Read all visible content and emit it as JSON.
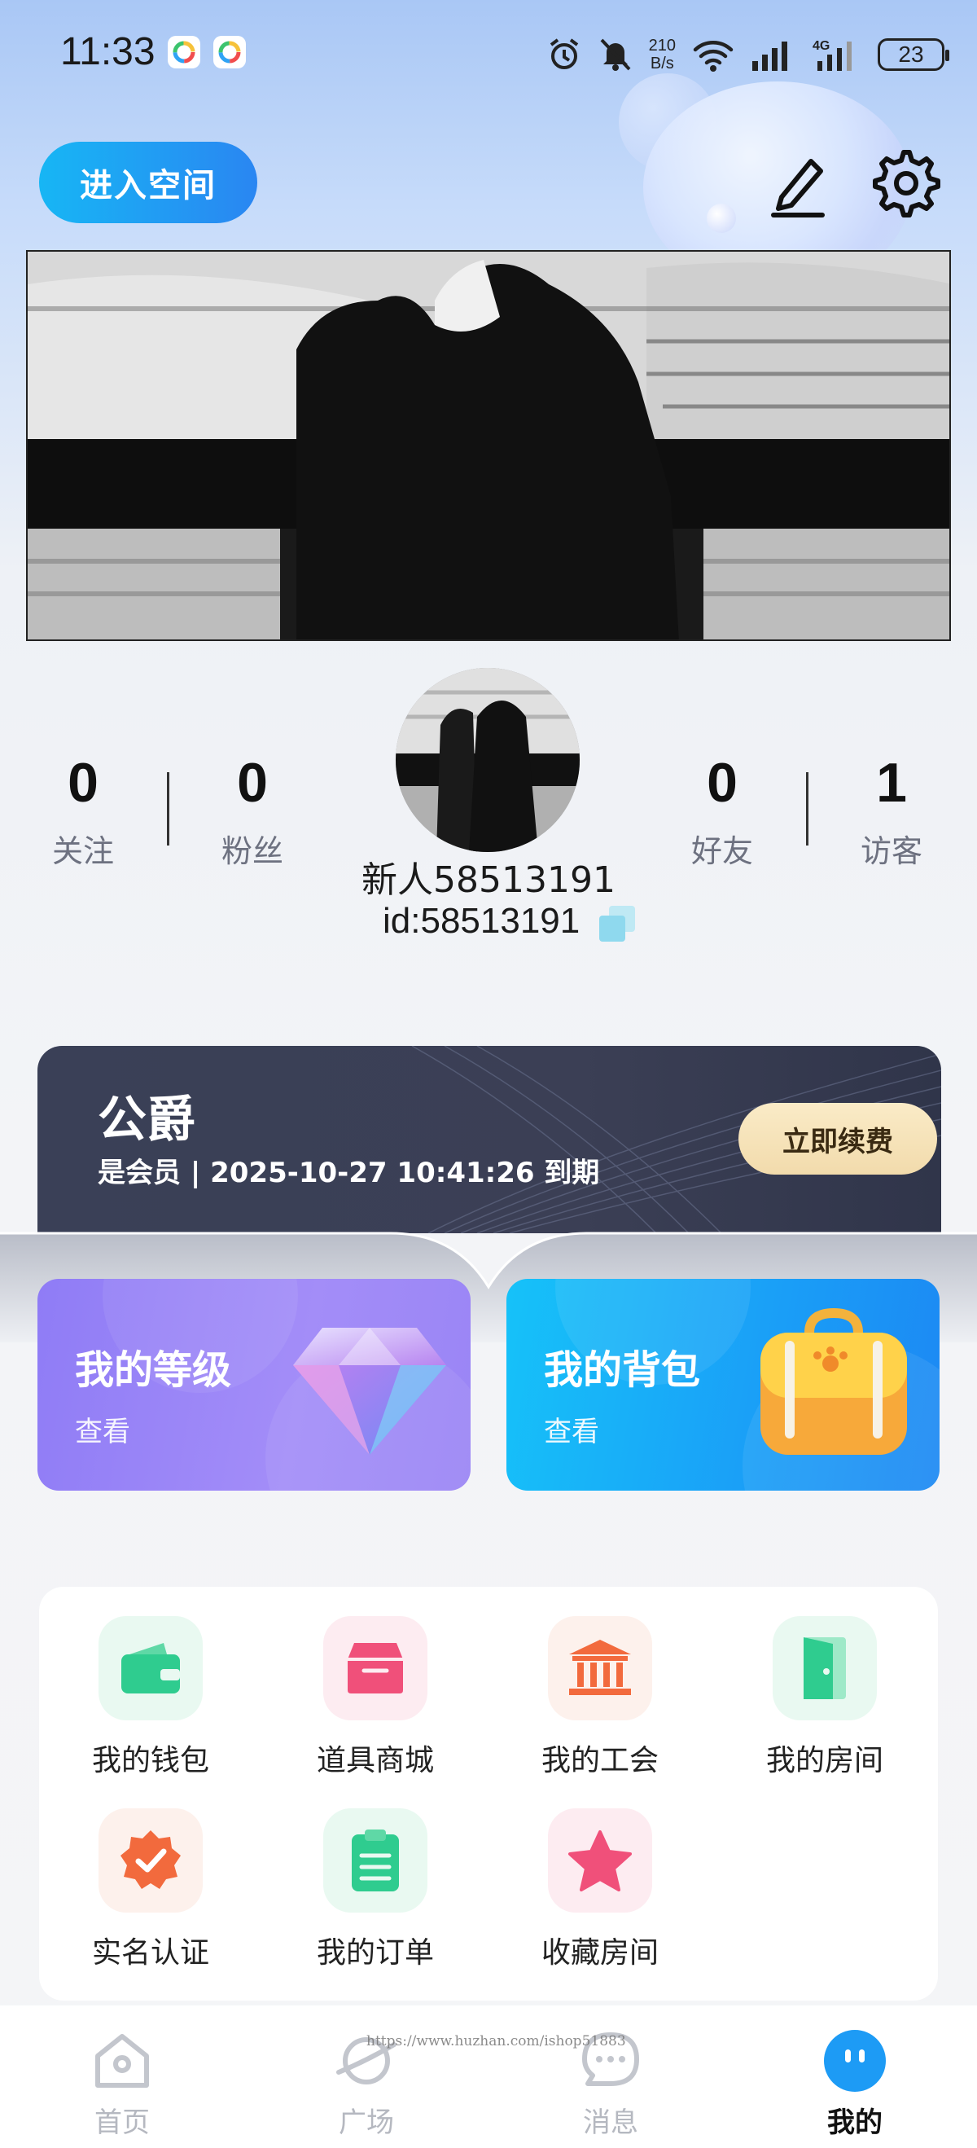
{
  "status_bar": {
    "time": "11:33",
    "net_speed_value": "210",
    "net_speed_unit": "B/s",
    "battery": "23",
    "icons": [
      "alarm-icon",
      "mute-icon",
      "wifi-icon",
      "signal-icon",
      "signal-4g-icon",
      "battery-icon"
    ]
  },
  "header": {
    "enter_space_label": "进入空间"
  },
  "profile": {
    "following_count": "0",
    "following_label": "关注",
    "fans_count": "0",
    "fans_label": "粉丝",
    "friends_count": "0",
    "friends_label": "好友",
    "visitors_count": "1",
    "visitors_label": "访客",
    "username": "新人58513191",
    "user_id": "id:58513191"
  },
  "vip": {
    "title": "公爵",
    "subtitle": "是会员 | 2025-10-27 10:41:26 到期",
    "renew_label": "立即续费"
  },
  "cards": {
    "level_title": "我的等级",
    "level_sub": "查看",
    "bag_title": "我的背包",
    "bag_sub": "查看"
  },
  "grid": {
    "items": [
      {
        "label": "我的钱包",
        "icon": "wallet-icon",
        "color": "#2fcc8f"
      },
      {
        "label": "道具商城",
        "icon": "shop-icon",
        "color": "#f0507a"
      },
      {
        "label": "我的工会",
        "icon": "guild-icon",
        "color": "#f26a3d"
      },
      {
        "label": "我的房间",
        "icon": "door-icon",
        "color": "#2fcc8f"
      },
      {
        "label": "实名认证",
        "icon": "verify-icon",
        "color": "#f26a3d"
      },
      {
        "label": "我的订单",
        "icon": "order-icon",
        "color": "#2fcc8f"
      },
      {
        "label": "收藏房间",
        "icon": "star-icon",
        "color": "#f0507a"
      }
    ]
  },
  "tabs": [
    {
      "label": "首页",
      "icon": "home-icon"
    },
    {
      "label": "广场",
      "icon": "planet-icon"
    },
    {
      "label": "消息",
      "icon": "chat-icon"
    },
    {
      "label": "我的",
      "icon": "profile-face-icon",
      "active": true
    }
  ],
  "watermark": "https://www.huzhan.com/ishop51883",
  "colors": {
    "accent_blue": "#1d9bf5",
    "vip_bg": "#3a4057",
    "renew_btn": "#f5e2b8",
    "level_card": "#9a85f5",
    "bag_card": "#1a9ef7"
  }
}
